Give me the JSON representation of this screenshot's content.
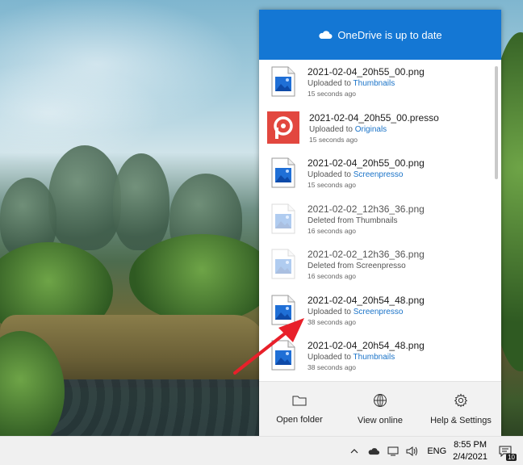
{
  "panel": {
    "header_title": "OneDrive is up to date",
    "items": [
      {
        "filename": "2021-02-04_20h55_00.png",
        "action": "Uploaded to",
        "folder": "Thumbnails",
        "time": "15 seconds ago",
        "icon": "image-file-icon",
        "faded": false
      },
      {
        "filename": "2021-02-04_20h55_00.presso",
        "action": "Uploaded to",
        "folder": "Originals",
        "time": "15 seconds ago",
        "icon": "screenpresso-file-icon",
        "faded": false
      },
      {
        "filename": "2021-02-04_20h55_00.png",
        "action": "Uploaded to",
        "folder": "Screenpresso",
        "time": "15 seconds ago",
        "icon": "image-file-icon",
        "faded": false
      },
      {
        "filename": "2021-02-02_12h36_36.png",
        "action": "Deleted from Thumbnails",
        "folder": "",
        "time": "16 seconds ago",
        "icon": "image-file-icon",
        "faded": true
      },
      {
        "filename": "2021-02-02_12h36_36.png",
        "action": "Deleted from Screenpresso",
        "folder": "",
        "time": "16 seconds ago",
        "icon": "image-file-icon",
        "faded": true
      },
      {
        "filename": "2021-02-04_20h54_48.png",
        "action": "Uploaded to",
        "folder": "Screenpresso",
        "time": "38 seconds ago",
        "icon": "image-file-icon",
        "faded": false
      },
      {
        "filename": "2021-02-04_20h54_48.png",
        "action": "Uploaded to",
        "folder": "Thumbnails",
        "time": "38 seconds ago",
        "icon": "image-file-icon",
        "faded": false
      }
    ],
    "footer": {
      "open_folder": "Open folder",
      "view_online": "View online",
      "help_settings": "Help & Settings"
    }
  },
  "taskbar": {
    "language": "ENG",
    "time": "8:55 PM",
    "date": "2/4/2021",
    "notification_count": "10"
  },
  "colors": {
    "header": "#1477d4",
    "link": "#1a73c8",
    "arrow": "#e8202a",
    "screenpresso": "#e2473f"
  }
}
